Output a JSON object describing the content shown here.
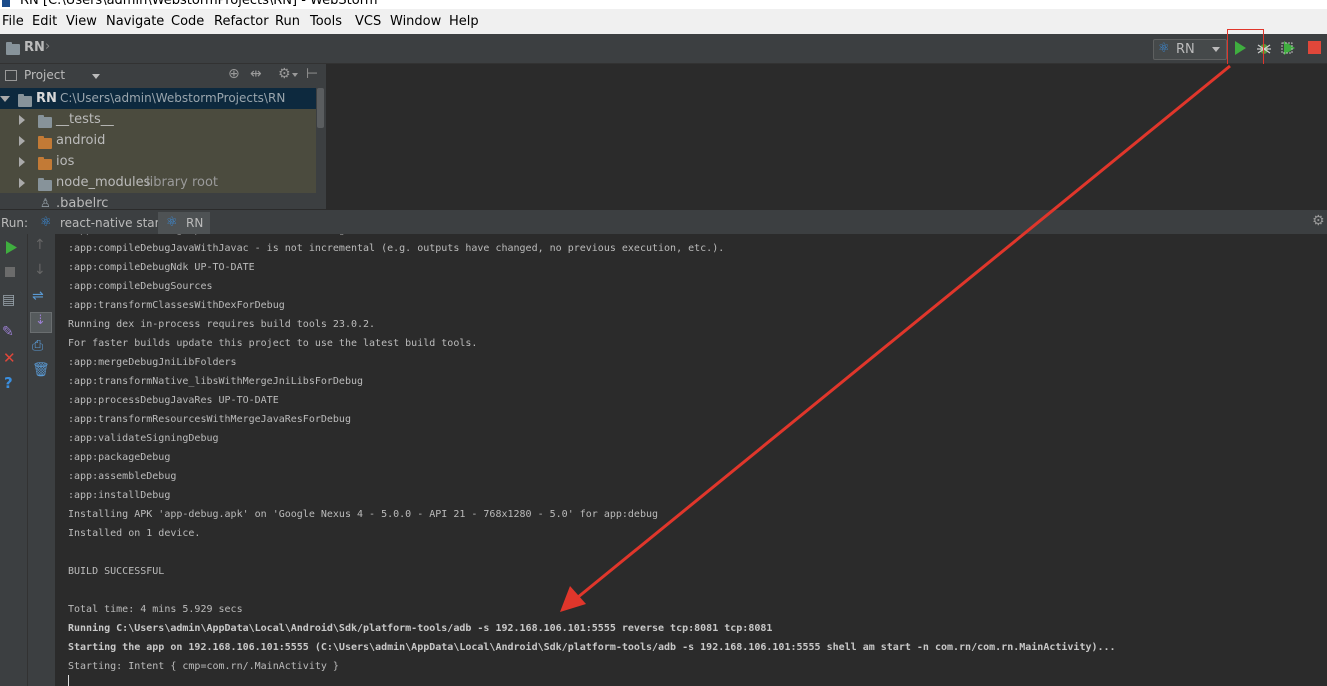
{
  "window": {
    "title": "RN [C:\\Users\\admin\\WebstormProjects\\RN] - WebStorm"
  },
  "menu": [
    "File",
    "Edit",
    "View",
    "Navigate",
    "Code",
    "Refactor",
    "Run",
    "Tools",
    "VCS",
    "Window",
    "Help"
  ],
  "navbar": {
    "crumb": "RN",
    "run_config": "RN"
  },
  "project": {
    "header": "Project",
    "tree": [
      {
        "name": "RN",
        "extra": "C:\\Users\\admin\\WebstormProjects\\RN"
      },
      {
        "name": "__tests__",
        "extra": ""
      },
      {
        "name": "android",
        "extra": ""
      },
      {
        "name": "ios",
        "extra": ""
      },
      {
        "name": "node_modules",
        "extra": "library root"
      },
      {
        "name": ".babelrc",
        "extra": ""
      }
    ]
  },
  "run": {
    "label": "Run:",
    "tabs": [
      "react-native start",
      "RN"
    ]
  },
  "console": {
    "lines": [
      ":app:compileDebugJavaWithJavac - is not incremental (e.g. outputs have changed, no previous execution, etc.).",
      ":app:compileDebugNdk UP-TO-DATE",
      ":app:compileDebugSources",
      ":app:transformClassesWithDexForDebug",
      "Running dex in-process requires build tools 23.0.2.",
      "For faster builds update this project to use the latest build tools.",
      ":app:mergeDebugJniLibFolders",
      ":app:transformNative_libsWithMergeJniLibsForDebug",
      ":app:processDebugJavaRes UP-TO-DATE",
      ":app:transformResourcesWithMergeJavaResForDebug",
      ":app:validateSigningDebug",
      ":app:packageDebug",
      ":app:assembleDebug",
      ":app:installDebug",
      "Installing APK 'app-debug.apk' on 'Google Nexus 4 - 5.0.0 - API 21 - 768x1280 - 5.0' for app:debug",
      "Installed on 1 device.",
      "",
      "BUILD SUCCESSFUL",
      "",
      "Total time: 4 mins 5.929 secs",
      "Running C:\\Users\\admin\\AppData\\Local\\Android\\Sdk/platform-tools/adb -s 192.168.106.101:5555 reverse tcp:8081 tcp:8081",
      "Starting the app on 192.168.106.101:5555 (C:\\Users\\admin\\AppData\\Local\\Android\\Sdk/platform-tools/adb -s 192.168.106.101:5555 shell am start -n com.rn/com.rn.MainActivity)...",
      "Starting: Intent { cmp=com.rn/.MainActivity }"
    ]
  },
  "colors": {
    "annotation_red": "#e0362b",
    "run_green": "#3fae3f",
    "stop_red": "#e0473a"
  }
}
